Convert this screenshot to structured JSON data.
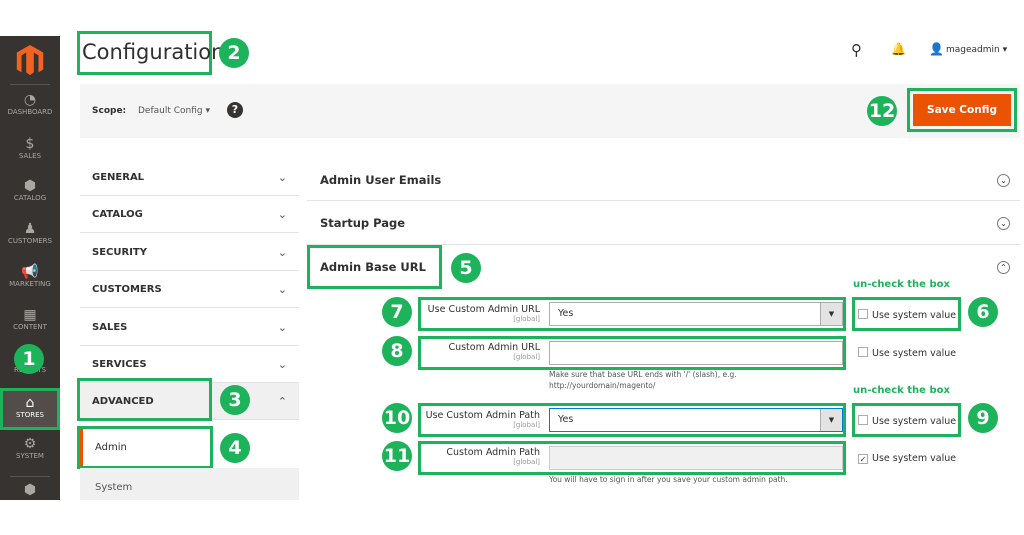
{
  "sidebar": {
    "items": [
      {
        "label": "DASHBOARD",
        "icon": "dashboard-icon"
      },
      {
        "label": "SALES",
        "icon": "dollar-icon"
      },
      {
        "label": "CATALOG",
        "icon": "box-icon"
      },
      {
        "label": "CUSTOMERS",
        "icon": "person-icon"
      },
      {
        "label": "MARKETING",
        "icon": "megaphone-icon"
      },
      {
        "label": "CONTENT",
        "icon": "layout-icon"
      },
      {
        "label": "REPORTS",
        "icon": "chart-icon"
      },
      {
        "label": "STORES",
        "icon": "store-icon",
        "active": true
      },
      {
        "label": "SYSTEM",
        "icon": "gear-icon"
      }
    ]
  },
  "header": {
    "title": "Configuration",
    "user": "mageadmin"
  },
  "scope": {
    "label": "Scope:",
    "value": "Default Config"
  },
  "save_label": "Save Config",
  "tabs": [
    "GENERAL",
    "CATALOG",
    "SECURITY",
    "CUSTOMERS",
    "SALES",
    "SERVICES",
    "ADVANCED"
  ],
  "subtabs": [
    "Admin",
    "System"
  ],
  "sections": [
    "Admin User Emails",
    "Startup Page",
    "Admin Base URL"
  ],
  "fields": [
    {
      "label": "Use Custom Admin URL",
      "scope": "[global]",
      "value": "Yes",
      "system": "Use system value",
      "checked": false
    },
    {
      "label": "Custom Admin URL",
      "scope": "[global]",
      "value": "",
      "system": "Use system value",
      "checked": false,
      "hint1": "Make sure that base URL ends with '/' (slash), e.g.",
      "hint2": "http://yourdomain/magento/"
    },
    {
      "label": "Use Custom Admin Path",
      "scope": "[global]",
      "value": "Yes",
      "system": "Use system value",
      "checked": false
    },
    {
      "label": "Custom Admin Path",
      "scope": "[global]",
      "value": "",
      "system": "Use system value",
      "checked": true,
      "hint1": "You will have to sign in after you save your custom admin path."
    }
  ],
  "annotations": {
    "uncheck": "un-check the box",
    "n": [
      "1",
      "2",
      "3",
      "4",
      "5",
      "6",
      "7",
      "8",
      "9",
      "10",
      "11",
      "12"
    ]
  },
  "colors": {
    "accent": "#eb5202",
    "annotation": "#1db35a",
    "sidebar": "#373330"
  }
}
